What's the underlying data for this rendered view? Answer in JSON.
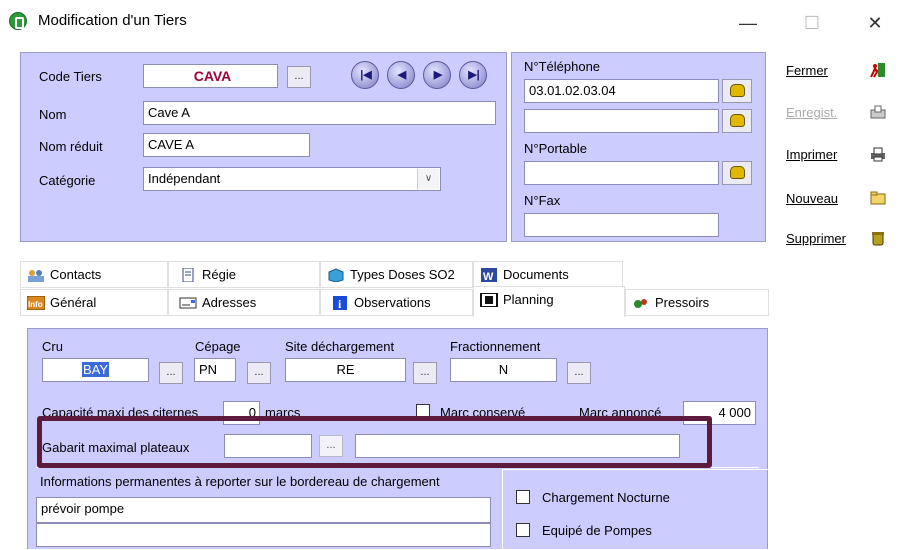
{
  "window": {
    "title": "Modification d'un Tiers",
    "minimize": "—",
    "maximize": "☐",
    "close": "✕"
  },
  "header": {
    "code_label": "Code Tiers",
    "code_value": "CAVA",
    "nom_label": "Nom",
    "nom_value": "Cave A",
    "nom_reduit_label": "Nom réduit",
    "nom_reduit_value": "CAVE A",
    "categorie_label": "Catégorie",
    "categorie_value": "Indépendant",
    "ellipsis": "..."
  },
  "nav": {
    "first": "|◀",
    "prev": "◀",
    "next": "▶",
    "last": "▶|"
  },
  "contact": {
    "tel_label": "N°Téléphone",
    "tel_value": "03.01.02.03.04",
    "tel2_value": "",
    "portable_label": "N°Portable",
    "portable_value": "",
    "fax_label": "N°Fax",
    "fax_value": ""
  },
  "actions": {
    "fermer": "Fermer",
    "enregist": "Enregist.",
    "imprimer": "Imprimer",
    "nouveau": "Nouveau",
    "supprimer": "Supprimer"
  },
  "tabs": {
    "row1": [
      "Contacts",
      "Régie",
      "Types Doses SO2",
      "Documents"
    ],
    "row2": [
      "Général",
      "Adresses",
      "Observations",
      "Planning",
      "Pressoirs"
    ]
  },
  "planning": {
    "cru_label": "Cru",
    "cru_value": "BAY",
    "cepage_label": "Cépage",
    "cepage_value": "PN",
    "site_label": "Site déchargement",
    "site_value": "RE",
    "fract_label": "Fractionnement",
    "fract_value": "N",
    "capacite_label": "Capacité maxi des citernes",
    "capacite_value": "0",
    "capacite_unit": "marcs",
    "marc_conserve_label": "Marc conservé",
    "marc_annonce_label": "Marc annoncé",
    "marc_annonce_value": "4 000",
    "gabarit_label": "Gabarit maximal plateaux",
    "gabarit_value": "",
    "gabarit_desc": "",
    "infos_label": "Informations permanentes à reporter sur le bordereau de chargement",
    "infos_value": "prévoir pompe",
    "chargement_label": "Chargement Nocturne",
    "equipe_label": "Equipé de Pompes"
  },
  "colors": {
    "panel": "#ccccff",
    "highlight": "#5c1a3c"
  }
}
